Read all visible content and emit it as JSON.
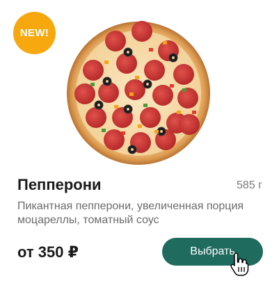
{
  "product": {
    "badge": "NEW!",
    "title": "Пепперони",
    "weight": "585 г",
    "description": "Пикантная пепперони, увеличенная порция моцареллы, томатный соус",
    "price": "от 350 ₽",
    "button_label": "Выбрать"
  },
  "colors": {
    "badge": "#f7a80f",
    "button": "#1f6b5e",
    "title": "#1a1a1a",
    "muted": "#6b6b6b"
  },
  "icons": {
    "cursor": "hand-pointer-icon",
    "image": "pepperoni-pizza-image"
  }
}
